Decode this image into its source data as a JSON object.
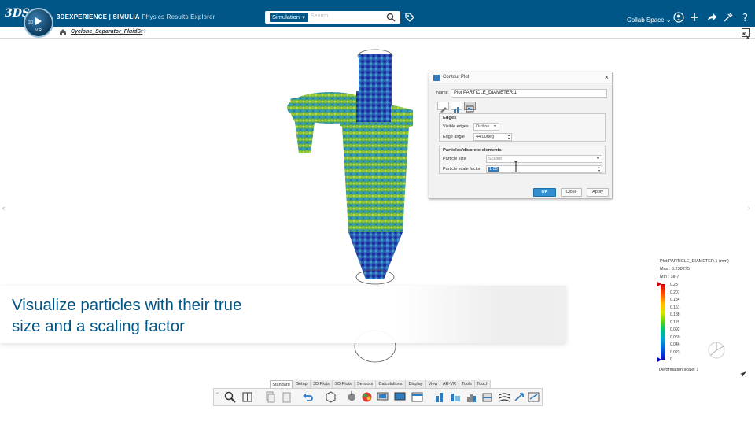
{
  "topbar": {
    "brand_logo": "3DS",
    "compass": {
      "mark": "3D",
      "version": "V.R"
    },
    "title_strong": "3DEXPERIENCE | SIMULIA",
    "title_thin": "Physics Results Explorer",
    "search": {
      "scope": "Simulation",
      "placeholder": "Search"
    },
    "space_label": "Collab Space",
    "icons": [
      "user-icon",
      "add-icon",
      "share-icon",
      "tools-icon",
      "help-icon"
    ]
  },
  "tabbar": {
    "doc_tab": "Cyclone_Separator_FluidSt"
  },
  "dialog": {
    "title": "Contour Plot",
    "name_label": "Name",
    "name_value": "Plot PARTICLE_DIAMETER.1",
    "edges": {
      "title": "Edges",
      "visible_label": "Visible edges",
      "visible_value": "Outline",
      "angle_label": "Edge angle",
      "angle_value": "44.00deg"
    },
    "particles": {
      "title": "Particles/discrete elements",
      "size_label": "Particle size",
      "size_value": "Scaled",
      "scale_label": "Particle scale factor",
      "scale_value": "1.00"
    },
    "buttons": {
      "ok": "OK",
      "close": "Close",
      "apply": "Apply"
    }
  },
  "banner": {
    "line1": "Visualize particles with their true",
    "line2": "size and a scaling factor"
  },
  "legend": {
    "title": "Plot PARTICLE_DIAMETER.1 (mm)",
    "max": "Max : 0.238275",
    "min": "Min : 1e-7",
    "ticks": [
      "0.23",
      "0.207",
      "0.184",
      "0.161",
      "0.138",
      "0.115",
      "0.092",
      "0.069",
      "0.046",
      "0.023",
      "0"
    ],
    "deformation": "Deformation scale: 1"
  },
  "ribbon": {
    "tabs": [
      "Standard",
      "Setup",
      "3D Plots",
      "2D Plots",
      "Sensors",
      "Calculations",
      "Display",
      "View",
      "AR-VR",
      "Tools",
      "Touch"
    ],
    "active_tab": "Standard"
  },
  "colors": {
    "brand": "#005686",
    "accent": "#2f8fd1"
  }
}
